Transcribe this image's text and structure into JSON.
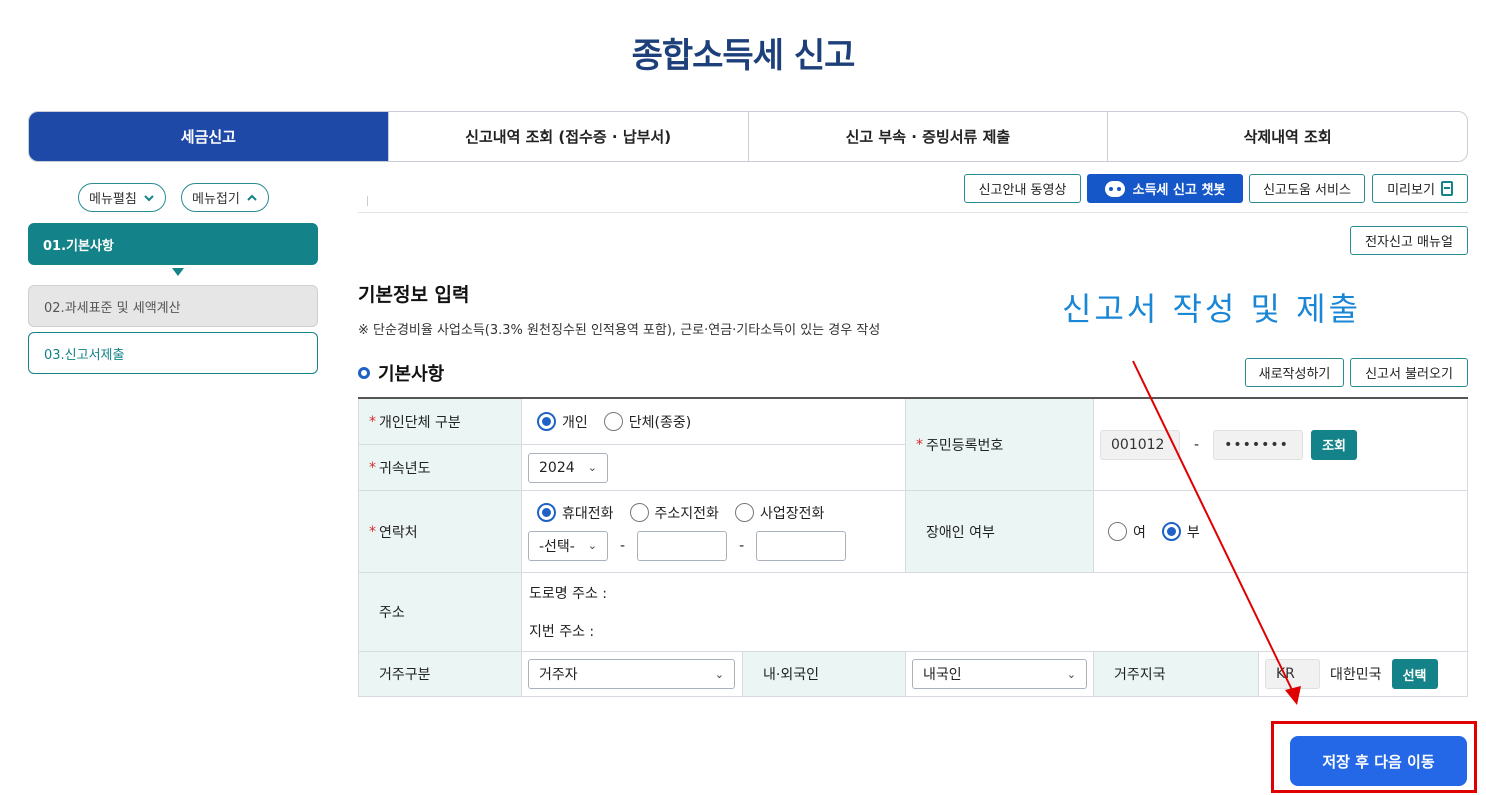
{
  "page_title": "종합소득세 신고",
  "tabs": [
    "세금신고",
    "신고내역 조회 (접수증 · 납부서)",
    "신고 부속 · 증빙서류 제출",
    "삭제내역 조회"
  ],
  "sidebar": {
    "expand_label": "메뉴펼침",
    "collapse_label": "메뉴접기",
    "steps": [
      "01.기본사항",
      "02.과세표준 및 세액계산",
      "03.신고서제출"
    ]
  },
  "toolbar": {
    "guide_video": "신고안내 동영상",
    "chatbot": "소득세 신고 챗봇",
    "help_service": "신고도움 서비스",
    "preview": "미리보기",
    "manual": "전자신고 매뉴얼"
  },
  "section": {
    "title": "기본정보 입력",
    "note": "※ 단순경비율 사업소득(3.3% 원천징수된 인적용역 포함), 근로·연금·기타소득이 있는 경우 작성",
    "subtitle": "기본사항",
    "new_button": "새로작성하기",
    "load_button": "신고서 불러오기"
  },
  "annotation_text": "신고서 작성 및 제출",
  "form": {
    "entity_label": "개인단체 구분",
    "entity_options": [
      "개인",
      "단체(종중)"
    ],
    "entity_selected": "개인",
    "year_label": "귀속년도",
    "year_value": "2024",
    "rrn_label": "주민등록번호",
    "rrn_front": "001012",
    "rrn_dash": "-",
    "rrn_back": "•••••••",
    "lookup_button": "조회",
    "contact_label": "연락처",
    "contact_options": [
      "휴대전화",
      "주소지전화",
      "사업장전화"
    ],
    "contact_selected": "휴대전화",
    "phone_select": "-선택-",
    "phone_dash": "-",
    "disability_label": "장애인 여부",
    "disability_options": [
      "여",
      "부"
    ],
    "disability_selected": "부",
    "address_label": "주소",
    "road_address": "도로명 주소 :",
    "lot_address": "지번 주소 :",
    "residence_label": "거주구분",
    "residence_value": "거주자",
    "nationality_label": "내·외국인",
    "nationality_value": "내국인",
    "country_label": "거주지국",
    "country_code": "KR",
    "country_name": "대한민국",
    "select_button": "선택"
  },
  "next_button": "저장 후 다음 이동",
  "colors": {
    "primary": "#1f49a6",
    "teal": "#138389",
    "blue_button": "#2468e8",
    "annotation": "#1a86d6",
    "highlight": "#e00000"
  }
}
